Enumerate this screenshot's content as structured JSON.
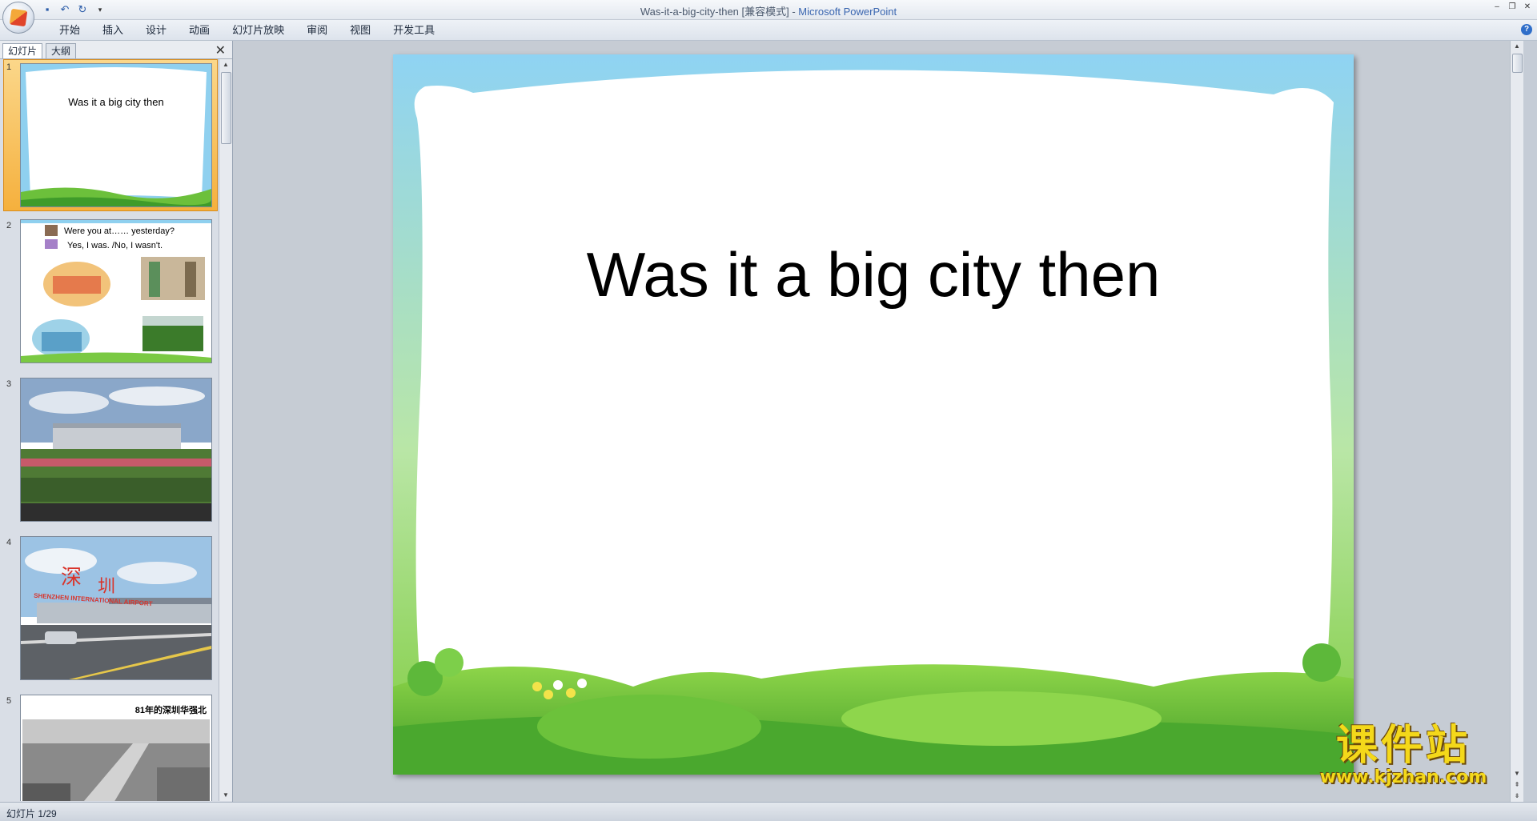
{
  "window": {
    "title_file": "Was-it-a-big-city-then [兼容模式] - ",
    "title_app": "Microsoft PowerPoint"
  },
  "ribbon": {
    "tabs": [
      "开始",
      "插入",
      "设计",
      "动画",
      "幻灯片放映",
      "审阅",
      "视图",
      "开发工具"
    ]
  },
  "left_pane": {
    "tabs": [
      "幻灯片",
      "大纲"
    ]
  },
  "thumbnails": [
    {
      "num": "1",
      "title": "Was it  a big  city then"
    },
    {
      "num": "2",
      "line1": "Were you at…… yesterday?",
      "line2": "Yes, I was.   /No, I wasn't."
    },
    {
      "num": "3"
    },
    {
      "num": "4",
      "sign": "SHENZHEN INTERNATIONAL AIRPORT",
      "char1": "深",
      "char2": "圳"
    },
    {
      "num": "5",
      "caption": "81年的深圳华强北"
    }
  ],
  "slide": {
    "title": "Was it a big city then"
  },
  "watermark": {
    "cn": "课件站",
    "url": "www.kjzhan.com"
  },
  "status": {
    "slide_counter": "幻灯片 1/29"
  }
}
